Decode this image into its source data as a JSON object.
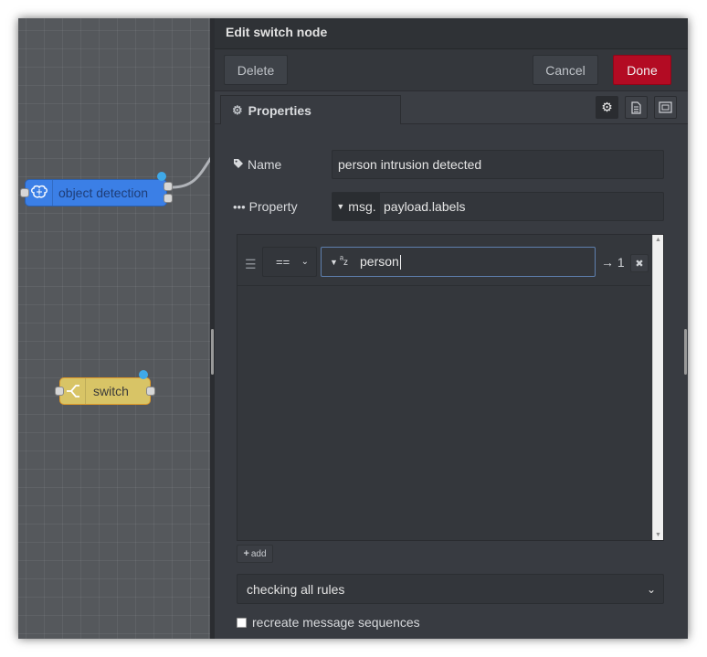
{
  "workspace": {
    "nodes": [
      {
        "label": "object detection",
        "color": "#3b7fe6"
      },
      {
        "label": "switch",
        "color": "#d8c466"
      }
    ]
  },
  "tray": {
    "title": "Edit switch node",
    "buttons": {
      "delete": "Delete",
      "cancel": "Cancel",
      "done": "Done"
    },
    "tabs": {
      "properties": "Properties"
    },
    "tab_icons": [
      "gear-icon",
      "document-icon",
      "appearance-icon"
    ]
  },
  "form": {
    "name": {
      "label": "Name",
      "value": "person intrusion detected"
    },
    "property": {
      "label": "Property",
      "type": "msg.",
      "value": "payload.labels"
    },
    "rules": [
      {
        "operator": "==",
        "value_type": "string",
        "value": "person",
        "output": "→ 1"
      }
    ],
    "add_label": "add",
    "mode": "checking all rules",
    "recreate": {
      "label": "recreate message sequences",
      "checked": false
    }
  },
  "colors": {
    "done_button": "#b30b23",
    "accent_blue": "#3fa9e8"
  }
}
